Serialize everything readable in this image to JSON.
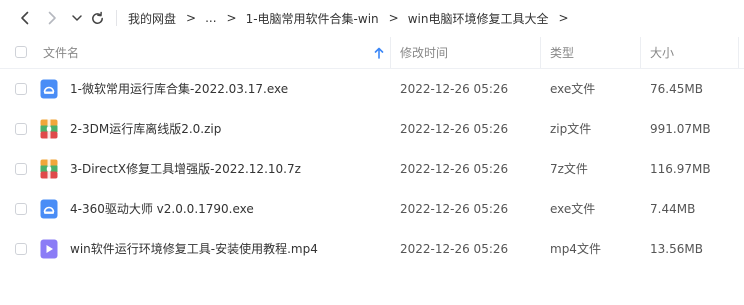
{
  "breadcrumb": {
    "items": [
      "我的网盘",
      "...",
      "1-电脑常用软件合集-win",
      "win电脑环境修复工具大全"
    ],
    "separator": ">"
  },
  "table": {
    "columns": {
      "name": "文件名",
      "modified": "修改时间",
      "type": "类型",
      "size": "大小"
    },
    "sort_icon": "arrow-up-icon",
    "rows": [
      {
        "name": "1-微软常用运行库合集-2022.03.17.exe",
        "modified": "2022-12-26 05:26",
        "type": "exe文件",
        "size": "76.45MB",
        "icon": "exe-icon"
      },
      {
        "name": "2-3DM运行库离线版2.0.zip",
        "modified": "2022-12-26 05:26",
        "type": "zip文件",
        "size": "991.07MB",
        "icon": "archive-icon"
      },
      {
        "name": "3-DirectX修复工具增强版-2022.12.10.7z",
        "modified": "2022-12-26 05:26",
        "type": "7z文件",
        "size": "116.97MB",
        "icon": "archive-icon"
      },
      {
        "name": "4-360驱动大师 v2.0.0.1790.exe",
        "modified": "2022-12-26 05:26",
        "type": "exe文件",
        "size": "7.44MB",
        "icon": "exe-icon"
      },
      {
        "name": "win软件运行环境修复工具-安装使用教程.mp4",
        "modified": "2022-12-26 05:26",
        "type": "mp4文件",
        "size": "13.56MB",
        "icon": "video-icon"
      }
    ]
  },
  "colors": {
    "exe_icon": "#4a8df6",
    "archive_icon_top": "#f0a63a",
    "archive_icon_mid": "#4ab06a",
    "archive_icon_bottom": "#e0494a",
    "video_icon": "#8b7cf6",
    "sort_arrow": "#3a86f7"
  }
}
